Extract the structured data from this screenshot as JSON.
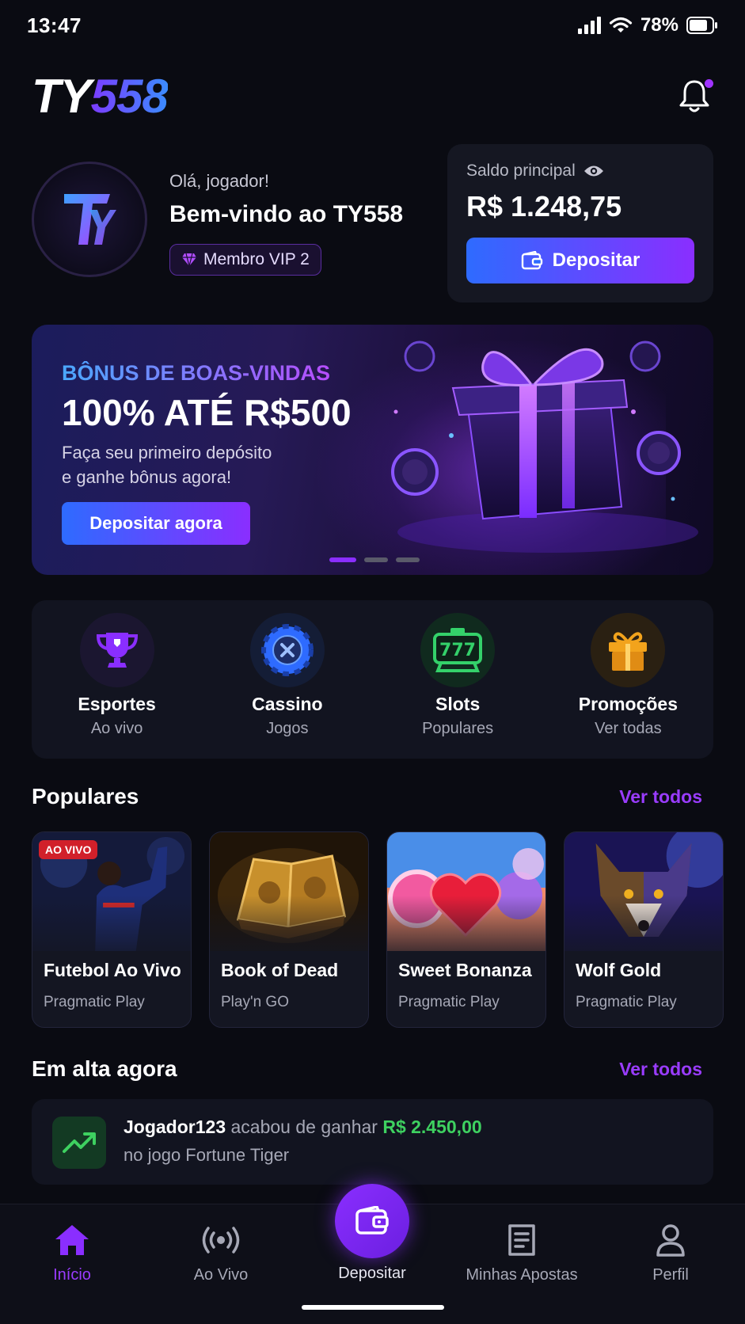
{
  "status_bar": {
    "time": "13:47",
    "battery": "78%"
  },
  "header": {
    "logo_ty": "TY",
    "logo_num": "558"
  },
  "user": {
    "greeting": "Olá, jogador!",
    "welcome": "Bem-vindo ao TY558",
    "vip": "Membro VIP 2"
  },
  "balance": {
    "label": "Saldo principal",
    "value": "R$ 1.248,75",
    "deposit_label": "Depositar"
  },
  "banner": {
    "kicker": "BÔNUS DE BOAS-VINDAS",
    "title": "100% ATÉ R$500",
    "desc_line1": "Faça seu primeiro depósito",
    "desc_line2": "e ganhe bônus agora!",
    "cta": "Depositar agora",
    "slide_count": 3,
    "active_slide": 1
  },
  "categories": [
    {
      "title": "Esportes",
      "sub": "Ao vivo",
      "icon": "trophy-icon"
    },
    {
      "title": "Cassino",
      "sub": "Jogos",
      "icon": "casino-chip-icon"
    },
    {
      "title": "Slots",
      "sub": "Populares",
      "icon": "slot-machine-icon"
    },
    {
      "title": "Promoções",
      "sub": "Ver todas",
      "icon": "gift-icon"
    }
  ],
  "popular": {
    "title": "Populares",
    "see_all": "Ver todos",
    "games": [
      {
        "title": "Futebol Ao Vivo",
        "provider": "Pragmatic Play",
        "badge": "AO VIVO"
      },
      {
        "title": "Book of Dead",
        "provider": "Play'n GO"
      },
      {
        "title": "Sweet Bonanza",
        "provider": "Pragmatic Play"
      },
      {
        "title": "Wolf Gold",
        "provider": "Pragmatic Play"
      }
    ]
  },
  "trending": {
    "title": "Em alta agora",
    "see_all": "Ver todos",
    "user": "Jogador123",
    "mid": "acabou de ganhar",
    "amount": "R$ 2.450,00",
    "game": "no jogo Fortune Tiger"
  },
  "tabbar": {
    "items": [
      {
        "label": "Início",
        "icon": "home-icon"
      },
      {
        "label": "Ao Vivo",
        "icon": "broadcast-icon"
      },
      {
        "label": "Depositar",
        "icon": "wallet-icon"
      },
      {
        "label": "Minhas Apostas",
        "icon": "receipt-icon"
      },
      {
        "label": "Perfil",
        "icon": "user-icon"
      }
    ]
  },
  "colors": {
    "accent": "#8a2eff",
    "blue": "#2e6bff",
    "win": "#3ed160",
    "bg": "#0a0b12"
  }
}
